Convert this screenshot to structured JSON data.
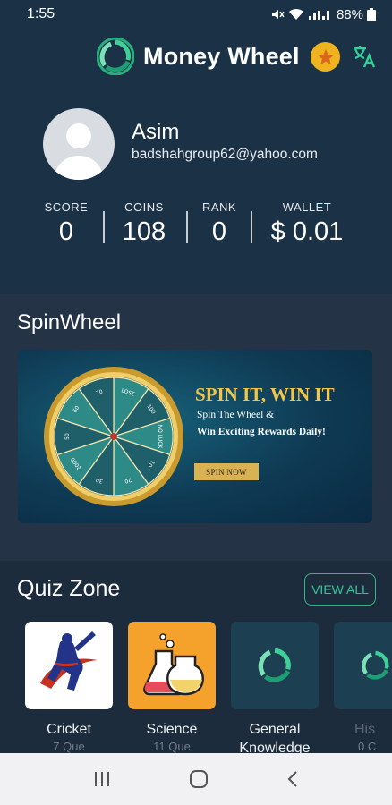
{
  "status": {
    "time": "1:55",
    "battery": "88%"
  },
  "header": {
    "title": "Money Wheel",
    "logo_icon": "spiral-logo-icon",
    "coin_icon": "star-coin-icon",
    "translate_icon": "translate-icon"
  },
  "profile": {
    "name": "Asim",
    "email": "badshahgroup62@yahoo.com",
    "stats": [
      {
        "label": "SCORE",
        "value": "0"
      },
      {
        "label": "COINS",
        "value": "108"
      },
      {
        "label": "RANK",
        "value": "0"
      },
      {
        "label": "WALLET",
        "value": "$ 0.01"
      }
    ]
  },
  "spin": {
    "section_title": "SpinWheel",
    "headline": "SPIN IT, WIN IT",
    "line1": "Spin The Wheel &",
    "line2": "Win Exciting Rewards Daily!",
    "button": "SPIN NOW",
    "wheel_labels": [
      "70",
      "LOSE",
      "100",
      "NO LUCK",
      "10",
      "20",
      "30",
      "2000",
      "50",
      "60"
    ]
  },
  "quiz": {
    "section_title": "Quiz Zone",
    "view_all": "VIEW ALL",
    "items": [
      {
        "label": "Cricket",
        "sub": "7 Que"
      },
      {
        "label": "Science",
        "sub": "11 Que"
      },
      {
        "label": "General Knowledge",
        "sub": ""
      },
      {
        "label": "His",
        "sub": "0 C"
      }
    ]
  },
  "colors": {
    "header_bg": "#1b3145",
    "accent_green": "#2fb889",
    "gold": "#f2c64a",
    "science_bg": "#f4a22b"
  }
}
